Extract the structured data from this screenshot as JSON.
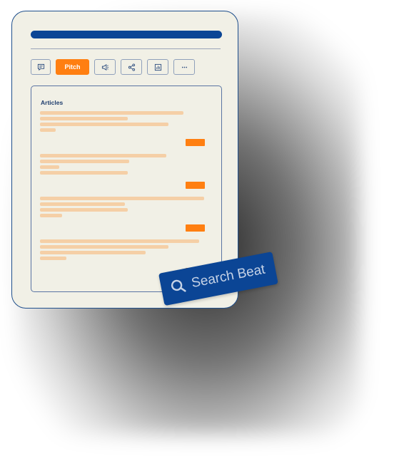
{
  "toolbar": {
    "buttons": [
      {
        "name": "comment-button",
        "icon": "comment-icon"
      },
      {
        "name": "pitch-button",
        "label": "Pitch"
      },
      {
        "name": "announce-button",
        "icon": "megaphone-icon"
      },
      {
        "name": "share-button",
        "icon": "share-icon"
      },
      {
        "name": "chart-button",
        "icon": "bar-chart-icon"
      },
      {
        "name": "more-button",
        "icon": "ellipsis-icon"
      }
    ],
    "pitch_label": "Pitch"
  },
  "articles": {
    "title": "Articles",
    "items": [
      {
        "lines": 4
      },
      {
        "lines": 4
      },
      {
        "lines": 4
      },
      {
        "lines": 4
      }
    ]
  },
  "search_badge": {
    "label": "Search Beat",
    "icon": "search-icon"
  },
  "colors": {
    "primary": "#0b4595",
    "accent": "#ff7f11",
    "placeholder_line": "#f5cfa6",
    "card_bg": "#f1f0e6"
  }
}
